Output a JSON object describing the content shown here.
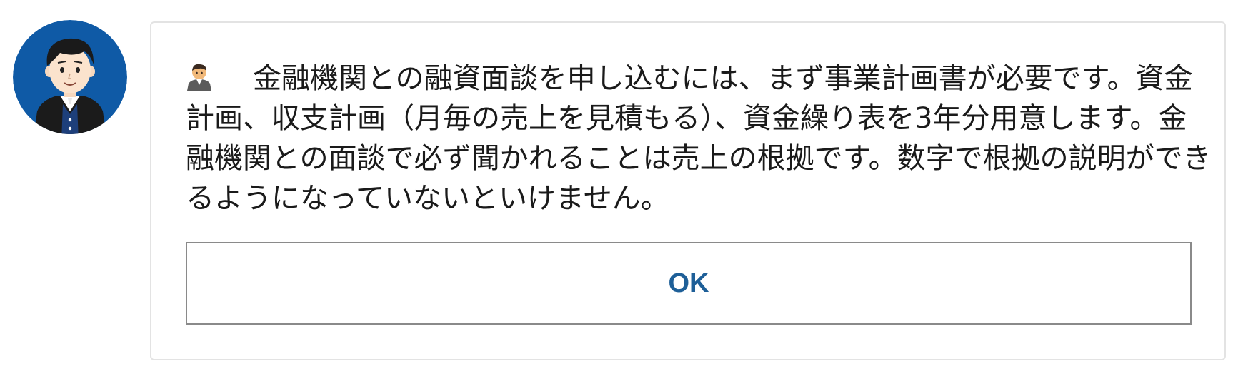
{
  "dialog": {
    "avatar_icon": "businessman-avatar",
    "speaker_icon": "person-emoji-icon",
    "message": "金融機関との融資面談を申し込むには、まず事業計画書が必要です。資金計画、収支計画（月毎の売上を見積もる）、資金繰り表を3年分用意します。金融機関との面談で必ず聞かれることは売上の根拠です。数字で根拠の説明ができるようになっていないといけません。",
    "ok_label": "OK"
  },
  "colors": {
    "avatar_background": "#0f5aa6",
    "button_text": "#1e5f98",
    "button_border": "#8a8a8a",
    "card_border": "#e3e3e3"
  }
}
